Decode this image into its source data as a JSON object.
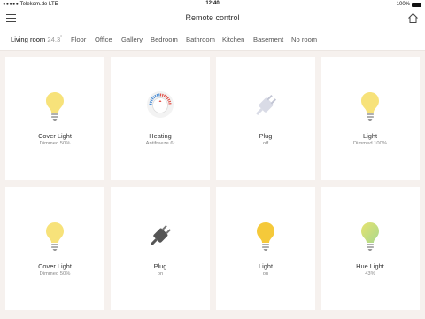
{
  "statusbar": {
    "carrier": "●●●●● Telekom.de",
    "network": "LTE",
    "time": "12:40",
    "battery": "100%"
  },
  "header": {
    "title": "Remote control",
    "menu_icon": "hamburger-menu-icon",
    "home_icon": "home-icon"
  },
  "rooms": {
    "active": {
      "label": "Living room",
      "temperature": "24.3",
      "degree": "°"
    },
    "items": [
      {
        "label": "Floor"
      },
      {
        "label": "Office"
      },
      {
        "label": "Gallery"
      },
      {
        "label": "Bedroom"
      },
      {
        "label": "Bathroom"
      },
      {
        "label": "Kitchen"
      },
      {
        "label": "Basement"
      },
      {
        "label": "No room"
      }
    ]
  },
  "devices": [
    {
      "name": "Cover Light",
      "status": "Dimmed 50%",
      "icon": "bulb-icon",
      "color": "#f7e27a"
    },
    {
      "name": "Heating",
      "status": "Antifreeze 6",
      "status_suffix": "°",
      "icon": "thermostat-icon"
    },
    {
      "name": "Plug",
      "status": "off",
      "icon": "plug-icon",
      "color": "#d9dbe6"
    },
    {
      "name": "Light",
      "status": "Dimmed 100%",
      "icon": "bulb-icon",
      "color": "#f7e27a"
    },
    {
      "name": "Cover Light",
      "status": "Dimmed 50%",
      "icon": "bulb-icon",
      "color": "#f7e27a"
    },
    {
      "name": "Plug",
      "status": "on",
      "icon": "plug-icon",
      "color": "#555555"
    },
    {
      "name": "Light",
      "status": "on",
      "icon": "bulb-icon",
      "color": "#f5c93a"
    },
    {
      "name": "Hue Light",
      "status": "43%",
      "icon": "hue-bulb-icon",
      "color": "#c7e07f"
    }
  ]
}
